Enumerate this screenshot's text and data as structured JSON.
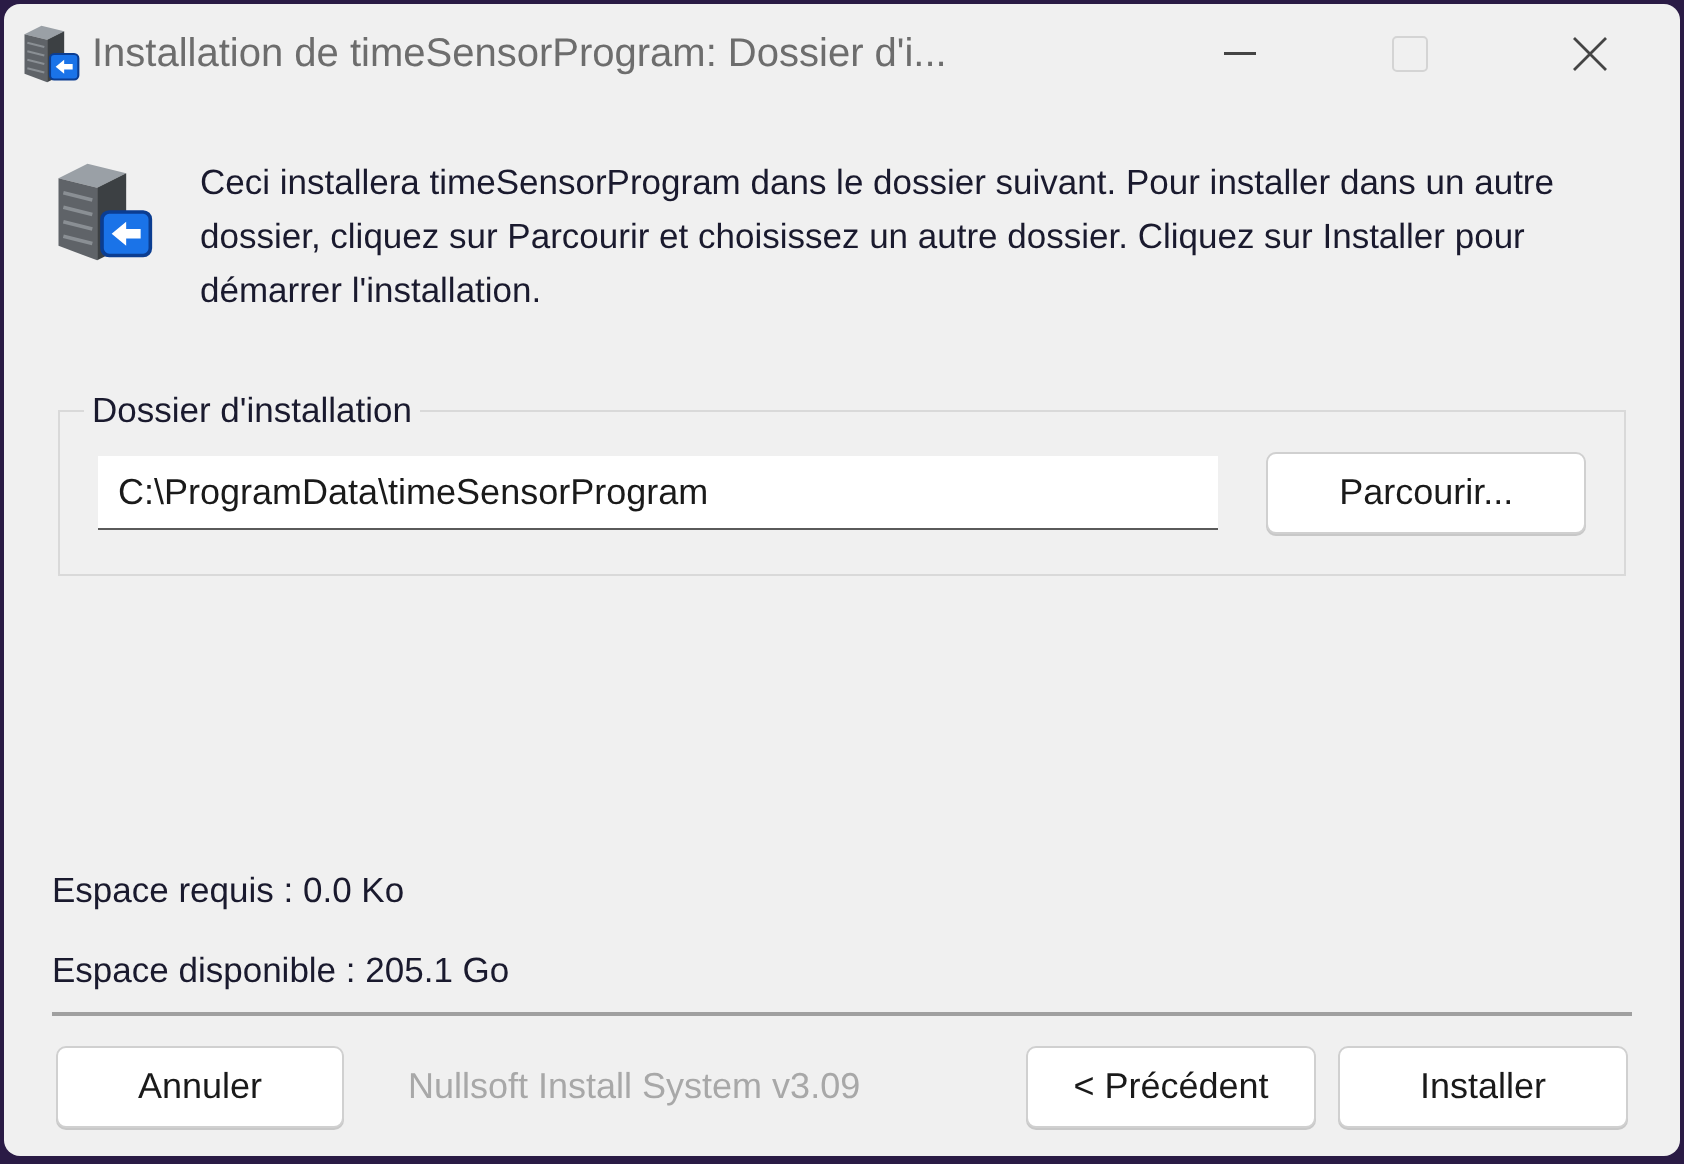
{
  "window": {
    "title": "Installation de timeSensorProgram: Dossier d'i...",
    "maximize_disabled": true
  },
  "intro": "Ceci installera timeSensorProgram dans le dossier suivant. Pour installer dans un autre dossier, cliquez sur Parcourir et choisissez un autre dossier. Cliquez sur Installer pour démarrer l'installation.",
  "folder_group": {
    "label": "Dossier d'installation",
    "path": "C:\\ProgramData\\timeSensorProgram",
    "browse_button": "Parcourir..."
  },
  "space_required": "Espace requis : 0.0 Ko",
  "space_available": "Espace disponible : 205.1 Go",
  "footer": {
    "cancel_button": "Annuler",
    "branding": "Nullsoft Install System v3.09",
    "back_button": "< Précédent",
    "install_button": "Installer"
  }
}
